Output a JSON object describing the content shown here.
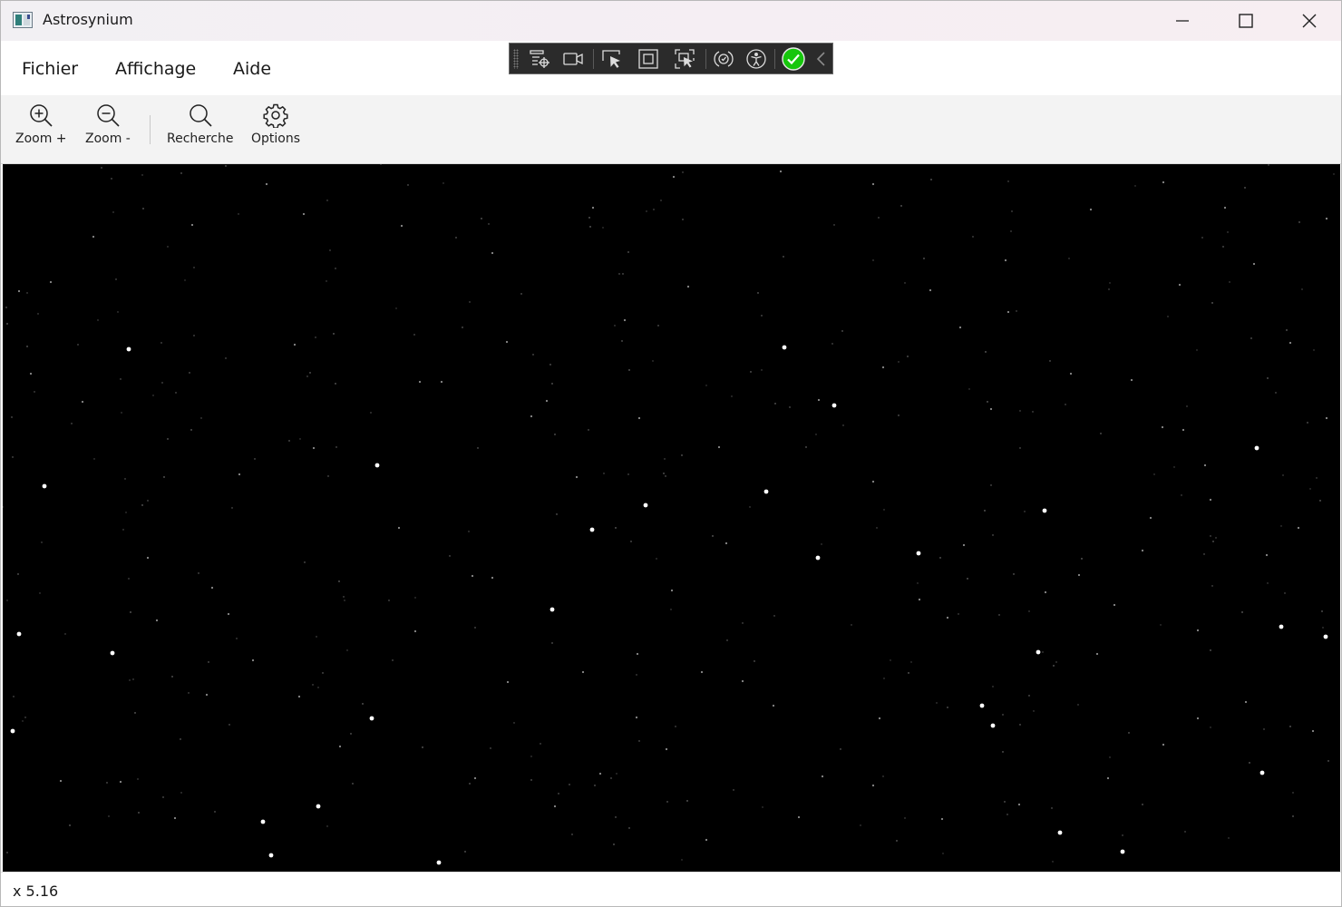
{
  "window": {
    "title": "Astrosynium"
  },
  "menu": {
    "items": [
      "Fichier",
      "Affichage",
      "Aide"
    ]
  },
  "toolbar": {
    "zoom_in_label": "Zoom +",
    "zoom_out_label": "Zoom -",
    "search_label": "Recherche",
    "options_label": "Options"
  },
  "debug_toolbar": {
    "icons": [
      "live-visual-tree-icon",
      "video-icon",
      "select-element-icon",
      "display-layout-adorners-icon",
      "track-focus-icon",
      "binding-failures-icon",
      "accessibility-icon",
      "hot-reload-status-icon",
      "collapse-chevron-icon"
    ]
  },
  "status": {
    "zoom_readout": "x 5.16"
  },
  "colors": {
    "sky": "#000000",
    "star": "#ffffff",
    "accent_green": "#16c60c"
  }
}
